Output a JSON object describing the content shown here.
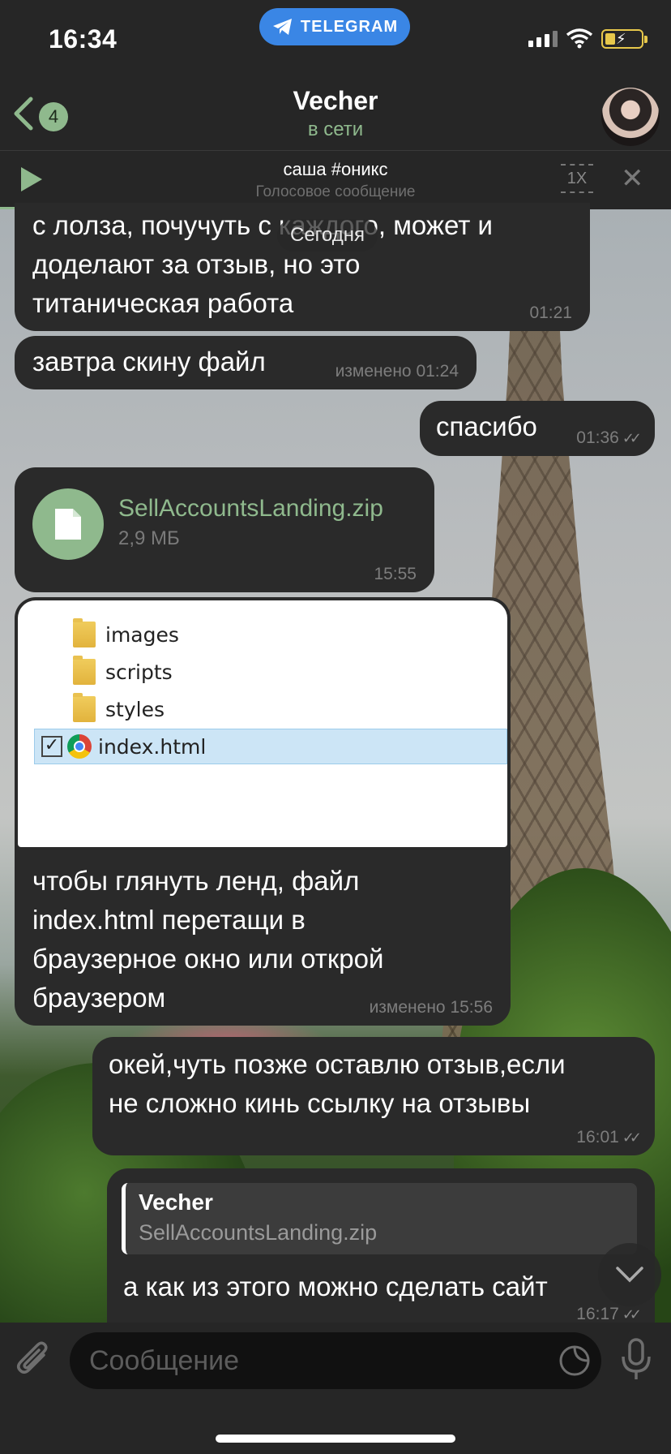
{
  "status": {
    "time": "16:34",
    "app_pill": "TELEGRAM"
  },
  "nav": {
    "back_count": "4",
    "title": "Vecher",
    "subtitle": "в сети"
  },
  "voice": {
    "title": "саша #оникс",
    "subtitle": "Голосовое сообщение",
    "speed": "1X",
    "progress": 0.36
  },
  "date_chip": "Сегодня",
  "messages": [
    {
      "text_lines": [
        "с лолза, почучуть с каждого, может и",
        "доделают за отзыв, но это",
        "титаническая работа"
      ],
      "time": "01:21"
    },
    {
      "text": "завтра скину файл",
      "time": "изменено 01:24"
    },
    {
      "text": "спасибо",
      "time": "01:36"
    },
    {
      "file_name": "SellAccountsLanding.zip",
      "file_size": "2,9 МБ",
      "time": "15:55"
    },
    {
      "folders": [
        "images",
        "scripts",
        "styles"
      ],
      "selected_file": "index.html",
      "text_lines": [
        "чтобы глянуть ленд, файл",
        "index.html перетащи в",
        "браузерное окно или открой",
        "браузером"
      ],
      "time": "изменено 15:56"
    },
    {
      "text_lines": [
        "окей,чуть позже оставлю отзыв,если",
        "не сложно кинь ссылку на отзывы"
      ],
      "time": "16:01"
    },
    {
      "reply_name": "Vecher",
      "reply_text": "SellAccountsLanding.zip",
      "text": "а как из этого можно сделать сайт",
      "time": "16:17"
    }
  ],
  "composer": {
    "placeholder": "Сообщение"
  }
}
